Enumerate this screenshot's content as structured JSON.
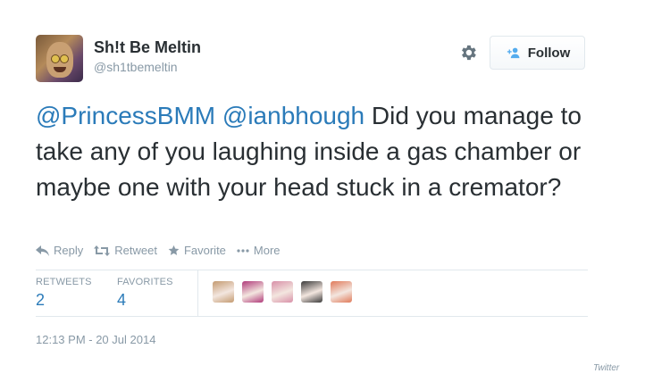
{
  "author": {
    "name": "Sh!t Be Meltin",
    "handle": "@sh1tbemeltin",
    "avatar_icon": "jar-jar-avatar"
  },
  "follow_button": {
    "label": "Follow",
    "icon": "add-user-icon"
  },
  "settings_icon": "gear-icon",
  "tweet": {
    "mention_1": "@PrincessBMM",
    "mention_2": "@ianbhough",
    "body": "Did you manage to take any of you laughing inside a gas chamber or maybe one with your head stuck in a cremator?"
  },
  "actions": {
    "reply": "Reply",
    "retweet": "Retweet",
    "favorite": "Favorite",
    "more": "More"
  },
  "stats": {
    "retweets_label": "RETWEETS",
    "retweets_value": "2",
    "favorites_label": "FAVORITES",
    "favorites_value": "4"
  },
  "favoriter_avatars": [
    "#c49a70",
    "#b03a7a",
    "#d890a8",
    "#3a3a3a",
    "#e07a5a"
  ],
  "timestamp": "12:13 PM - 20 Jul 2014",
  "brand": "Twitter",
  "colors": {
    "link": "#2b7bb9",
    "muted": "#8899a6",
    "text": "#292f33"
  }
}
